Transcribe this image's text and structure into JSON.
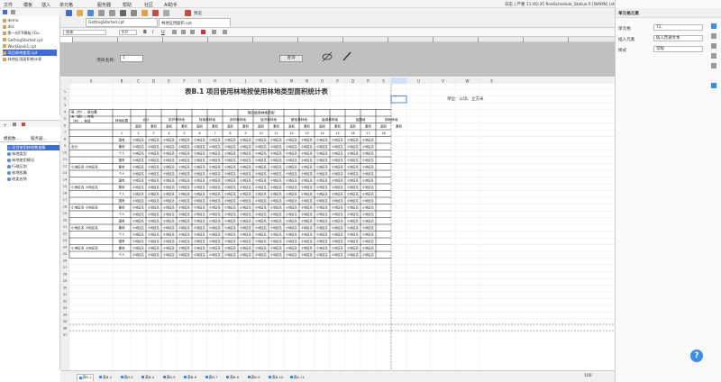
{
  "menu": [
    "文件",
    "模板",
    "插入",
    "单元格",
    "服务器",
    "帮助",
    "社区",
    "AI助手"
  ],
  "status_text": "日志 | 严重 11:40:35 fineSchedule_Status-5 [WARN] (standard) mail",
  "user": "ufGuoQu",
  "file_tree": [
    "demo",
    "doc",
    "第一份FR模板 (Gu",
    "GettingStarted.cpt",
    "WorkBook1.cpt",
    "项目林地使用.cpt",
    "林地征用面积统计表"
  ],
  "template_tabs": [
    "模板数...",
    "服务器..."
  ],
  "template_tree": [
    "项目使用林地数据集",
    "林地类型",
    "林地使用情况",
    "行政区划",
    "林地权属",
    "地类名称"
  ],
  "doc_tabs": [
    "GettingStarted.cpt",
    "林地征用面积.cpt"
  ],
  "preview_label": "预览",
  "font_name": "宋体",
  "font_size": "9.0",
  "param_label": "项目名称:",
  "param_value": "1",
  "query_button": "查询",
  "col_letters": [
    "A",
    "B",
    "C",
    "D",
    "E",
    "F",
    "G",
    "H",
    "I",
    "J",
    "K",
    "L",
    "M",
    "N",
    "O",
    "P",
    "Q",
    "R",
    "S",
    "T",
    "U",
    "V",
    "W",
    "X"
  ],
  "row_count": 37,
  "report": {
    "title": "表B.1  项目使用林地按使用林地类型面积统计表",
    "unit_note": "单位：公顷、立方米",
    "stub_header": [
      "县（市）、县位置",
      "乡（镇）、林场",
      "（村）、林班"
    ],
    "col_b_header": "林地权属",
    "group_header": "项目使用林地类型",
    "categories": [
      "合计",
      "防护林林地",
      "特用林林地",
      "用材林林地",
      "经济林林地",
      "薪炭林林地",
      "能源林林地",
      "苗圃地",
      "其他林地"
    ],
    "sub_headers": [
      "面积",
      "蓄积"
    ],
    "number_row": [
      "1",
      "2",
      "3",
      "4",
      "5",
      "6",
      "7",
      "8",
      "9",
      "10",
      "11",
      "12",
      "13",
      "14",
      "15",
      "16",
      "17",
      "18"
    ],
    "row_groups": [
      "合计",
      "小地区名 小地区名",
      "小地区名 小地区名",
      "小地区名 小地区名",
      "小地区名 小地区名",
      "小地区名 小地区名"
    ],
    "ownership": [
      "国有",
      "集体",
      "个人"
    ],
    "cell_text": "小地区名"
  },
  "sheet_tabs": [
    "表B.1",
    "表B.2",
    "表B.3",
    "表B.4",
    "表B.5",
    "表B.6",
    "表B.7",
    "表B.8",
    "表B.9",
    "表B.10",
    "表B.11"
  ],
  "zoom": "100",
  "right_panel": {
    "title": "单元格元素",
    "cell_label": "单元格",
    "cell_value": "T2",
    "insert_label": "插入元素",
    "insert_value": "插入普通文本",
    "style_label": "样式",
    "style_value": "常规"
  }
}
